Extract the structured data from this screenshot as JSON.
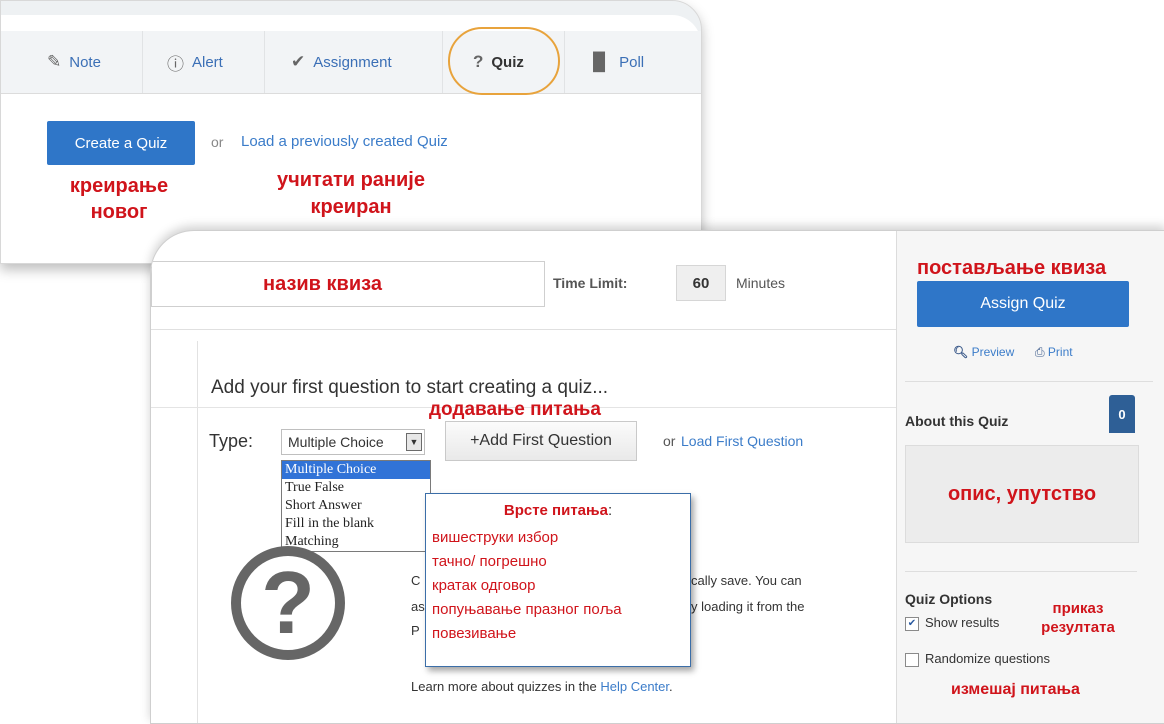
{
  "top_panel": {
    "tabs": [
      {
        "label": "Note",
        "icon": "note-icon"
      },
      {
        "label": "Alert",
        "icon": "alert-icon"
      },
      {
        "label": "Assignment",
        "icon": "assignment-icon"
      },
      {
        "label": "Quiz",
        "icon": "quiz-icon"
      },
      {
        "label": "Poll",
        "icon": "poll-icon"
      }
    ],
    "create_button": "Create a Quiz",
    "or_text": "or",
    "load_link": "Load a previously created Quiz",
    "annotations": {
      "create_line1": "креирање",
      "create_line2": "новог",
      "load_line1": "учитати раније",
      "load_line2": "креиран"
    }
  },
  "editor": {
    "title_annotation": "назив квиза",
    "time_limit_label": "Time Limit:",
    "time_limit_value": "60",
    "time_limit_unit": "Minutes",
    "heading": "Add your first question to start creating a quiz...",
    "add_question_annotation": "додавање питања",
    "type_label": "Type:",
    "type_selected": "Multiple Choice",
    "type_options": [
      "Multiple Choice",
      "True False",
      "Short Answer",
      "Fill in the blank",
      "Matching"
    ],
    "add_first_button": "+Add First Question",
    "or_text": "or",
    "load_first_link": "Load First Question",
    "question_types_callout": {
      "title": "Врсте питања",
      "colon": ":",
      "items": [
        "вишеструки избор",
        "тачно/ погрешно",
        "кратак одговор",
        "попуњавање празног поља",
        "повезивање"
      ]
    },
    "body_fragments": {
      "l1_left": "C",
      "l1_right": "cally save. You can",
      "l2_left": "as",
      "l2_right": "y loading it from the",
      "l3_left": "P"
    },
    "help_text": "Learn more about quizzes in the",
    "help_link": "Help Center",
    "help_period": "."
  },
  "sidebar": {
    "assign_annotation": "постављање квиза",
    "assign_button": "Assign Quiz",
    "preview_link": "Preview",
    "print_link": "Print",
    "about_title": "About this Quiz",
    "about_badge": "0",
    "description_annotation": "опис, упутство",
    "options_title": "Quiz Options",
    "show_results": "Show results",
    "show_results_checked": true,
    "randomize": "Randomize questions",
    "randomize_checked": false,
    "results_annotation_line1": "приказ",
    "results_annotation_line2": "резултата",
    "shuffle_annotation": "измешај питања"
  },
  "colors": {
    "primary_blue": "#2f76c8",
    "link_blue": "#3b7cc9",
    "annotation_red": "#d0141b",
    "quiz_highlight": "#e8a33c"
  }
}
